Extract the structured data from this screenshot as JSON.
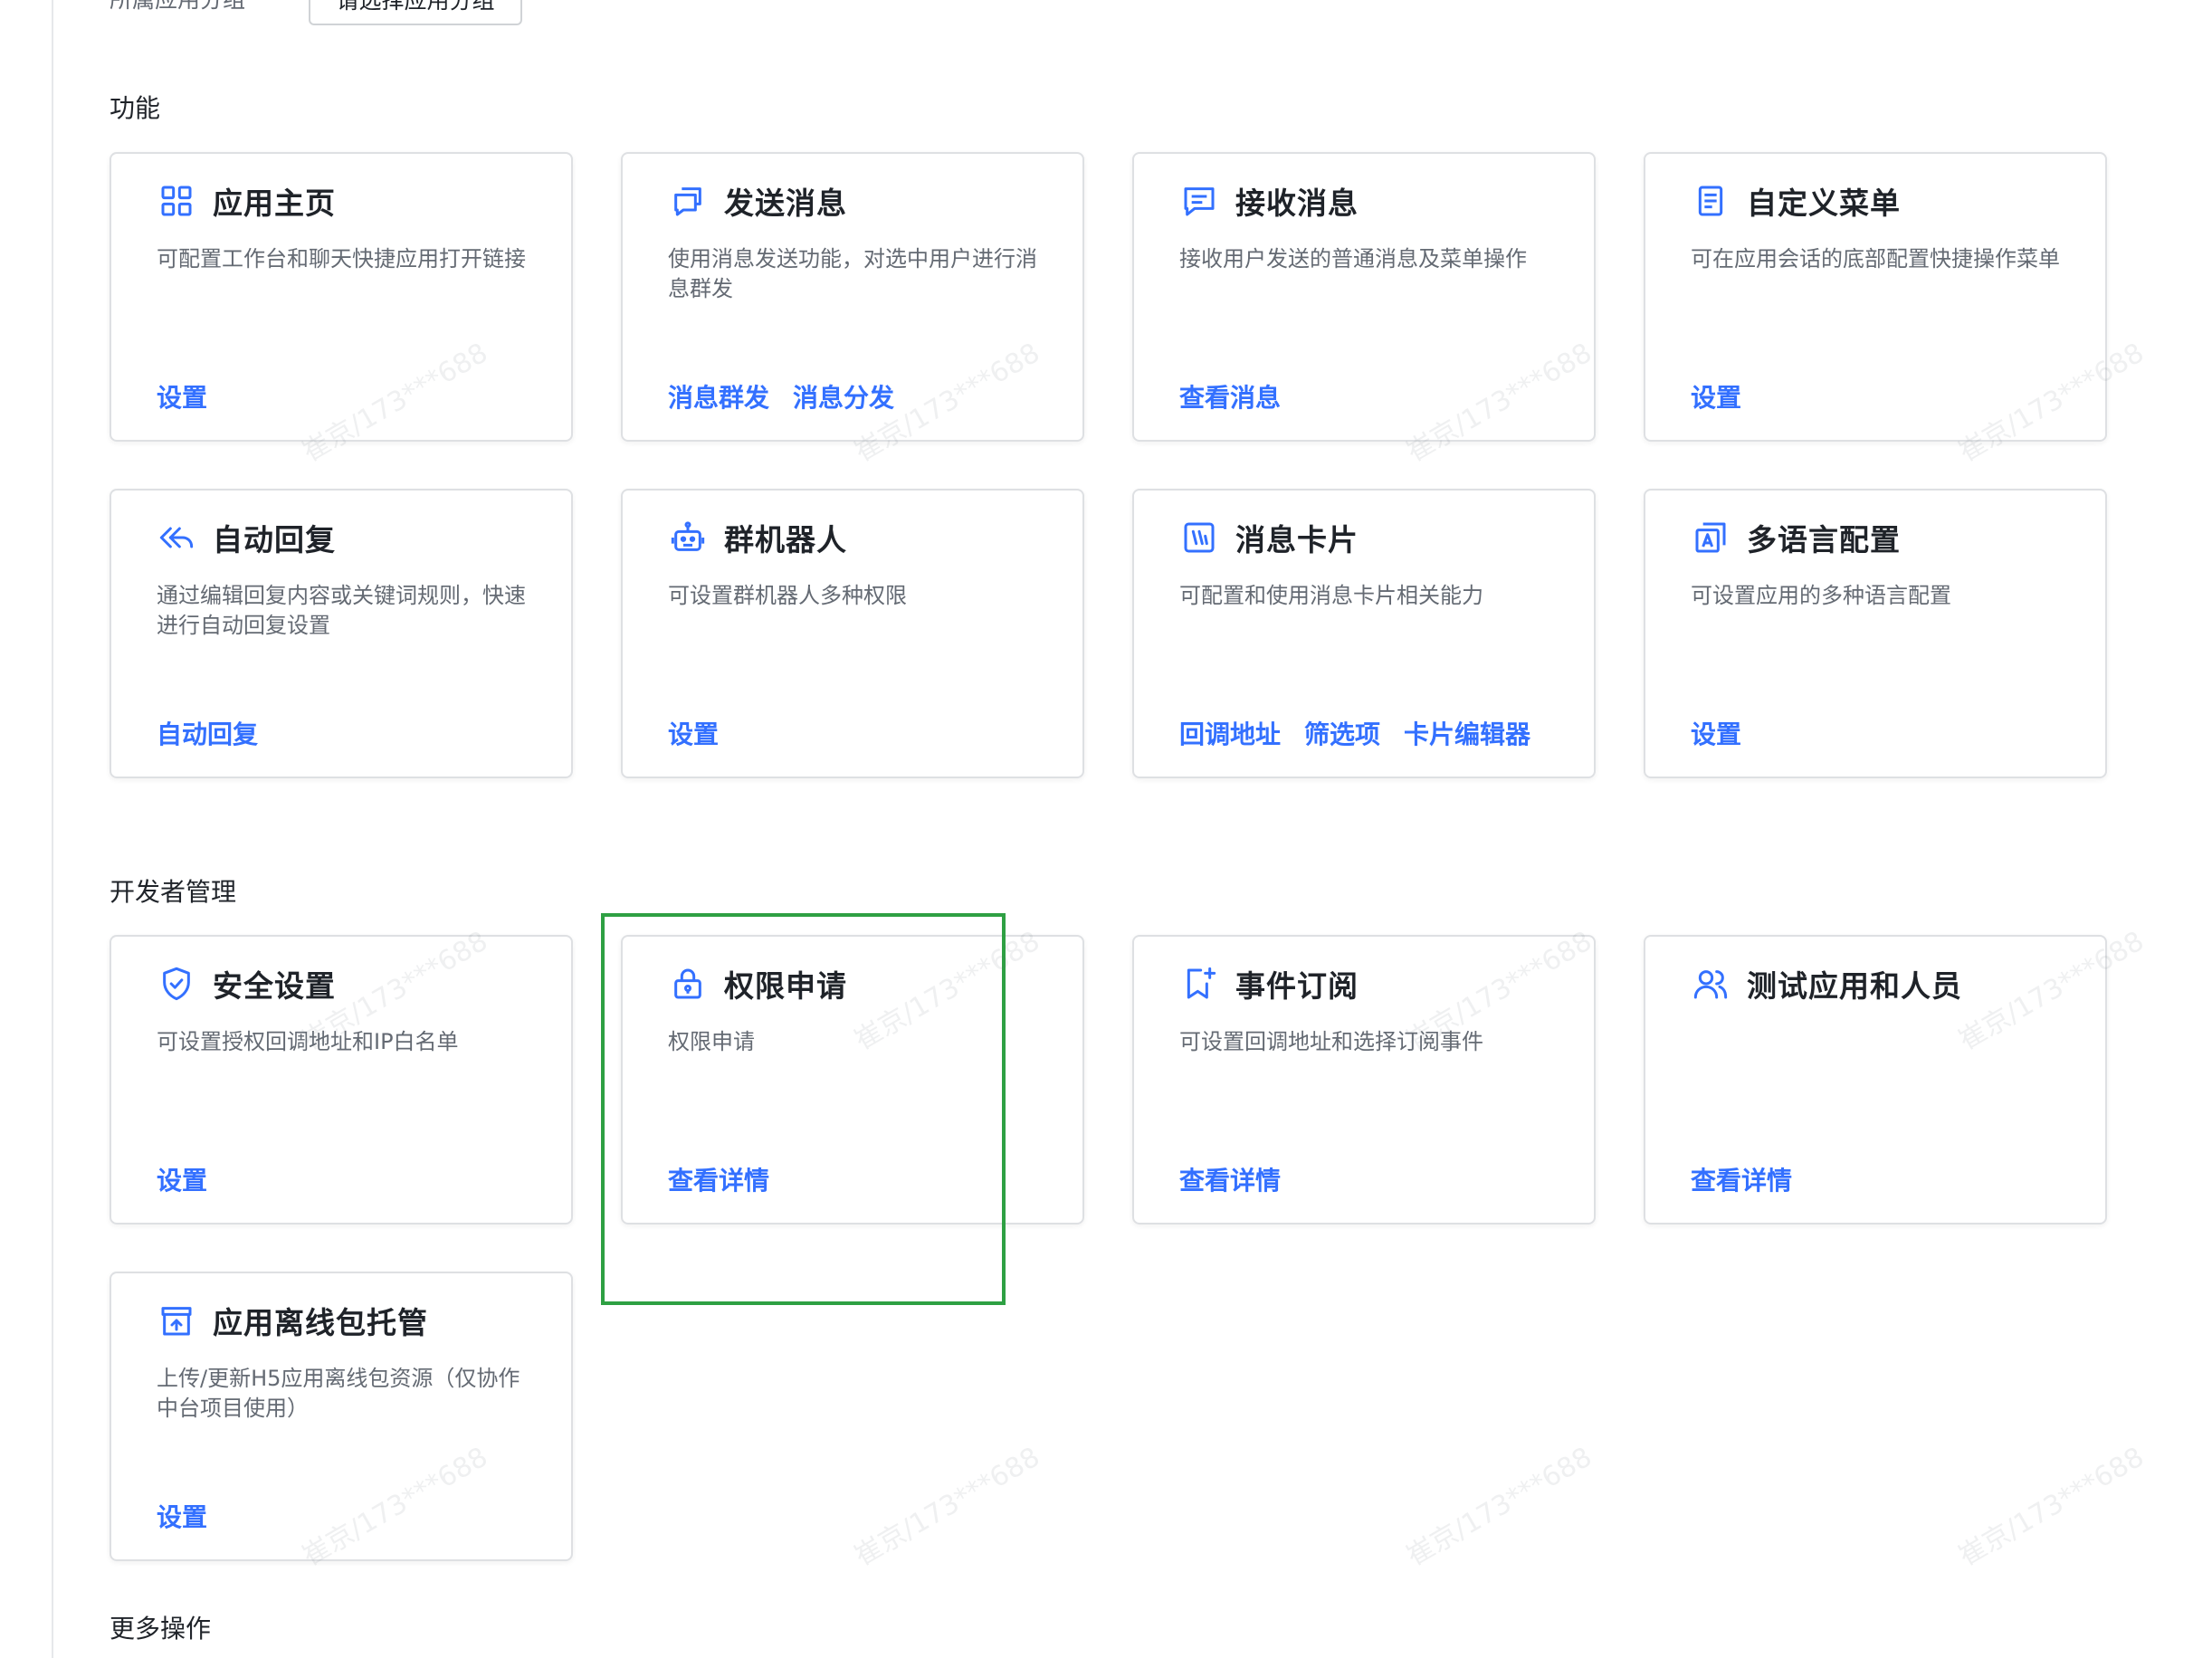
{
  "top": {
    "label": "所属应用分组",
    "button": "请选择应用分组"
  },
  "sections": {
    "features": "功能",
    "developer": "开发者管理",
    "more": "更多操作"
  },
  "cards": [
    {
      "title": "应用主页",
      "icon": "grid-icon",
      "desc": "可配置工作台和聊天快捷应用打开链接",
      "actions": [
        "设置"
      ]
    },
    {
      "title": "发送消息",
      "icon": "chat-bubbles-icon",
      "desc": "使用消息发送功能，对选中用户进行消息群发",
      "actions": [
        "消息群发",
        "消息分发"
      ]
    },
    {
      "title": "接收消息",
      "icon": "message-icon",
      "desc": "接收用户发送的普通消息及菜单操作",
      "actions": [
        "查看消息"
      ]
    },
    {
      "title": "自定义菜单",
      "icon": "menu-document-icon",
      "desc": "可在应用会话的底部配置快捷操作菜单",
      "actions": [
        "设置"
      ]
    },
    {
      "title": "自动回复",
      "icon": "reply-all-icon",
      "desc": "通过编辑回复内容或关键词规则，快速进行自动回复设置",
      "actions": [
        "自动回复"
      ]
    },
    {
      "title": "群机器人",
      "icon": "robot-icon",
      "desc": "可设置群机器人多种权限",
      "actions": [
        "设置"
      ]
    },
    {
      "title": "消息卡片",
      "icon": "message-card-icon",
      "desc": "可配置和使用消息卡片相关能力",
      "actions": [
        "回调地址",
        "筛选项",
        "卡片编辑器"
      ]
    },
    {
      "title": "多语言配置",
      "icon": "language-icon",
      "desc": "可设置应用的多种语言配置",
      "actions": [
        "设置"
      ]
    },
    {
      "title": "安全设置",
      "icon": "shield-check-icon",
      "desc": "可设置授权回调地址和IP白名单",
      "actions": [
        "设置"
      ]
    },
    {
      "title": "权限申请",
      "icon": "lock-icon",
      "desc": "权限申请",
      "actions": [
        "查看详情"
      ]
    },
    {
      "title": "事件订阅",
      "icon": "bookmark-plus-icon",
      "desc": "可设置回调地址和选择订阅事件",
      "actions": [
        "查看详情"
      ]
    },
    {
      "title": "测试应用和人员",
      "icon": "users-icon",
      "desc": "",
      "actions": [
        "查看详情"
      ]
    },
    {
      "title": "应用离线包托管",
      "icon": "package-upload-icon",
      "desc": "上传/更新H5应用离线包资源（仅协作中台项目使用）",
      "actions": [
        "设置"
      ]
    }
  ],
  "watermark": "崔京/173***688",
  "colors": {
    "accent": "#3370ff",
    "highlight": "#2ea043"
  }
}
